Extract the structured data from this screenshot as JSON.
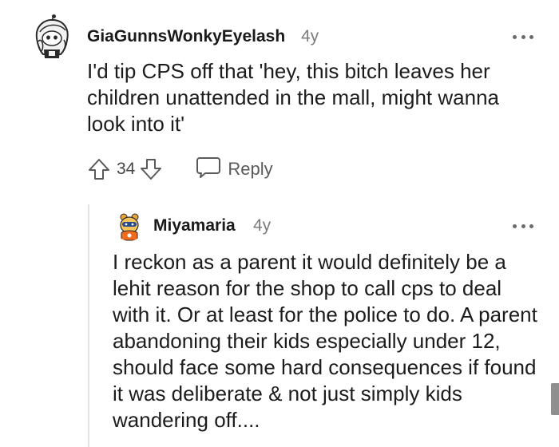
{
  "comment": {
    "username": "GiaGunnsWonkyEyelash",
    "age": "4y",
    "body": "I'd tip CPS off that 'hey, this bitch leaves her children unattended in the mall, might wanna look into it'",
    "score": "34",
    "reply_label": "Reply",
    "avatar_icon": "snoo-avatar-icon",
    "reply": {
      "username": "Miyamaria",
      "age": "4y",
      "body": "I reckon as a parent it would definitely be a lehit reason for the shop to call cps to deal with it. Or at least for the police to do. A parent abandoning their kids especially under 12, should face some hard consequences if found it was deliberate & not just simply kids wandering off....",
      "avatar_icon": "snoo-avatar-icon"
    }
  },
  "colors": {
    "text": "#1a1a1b",
    "muted": "#7c7c7c",
    "thread_line": "#e2e2e2",
    "avatar_accent": "#f26b1d"
  }
}
